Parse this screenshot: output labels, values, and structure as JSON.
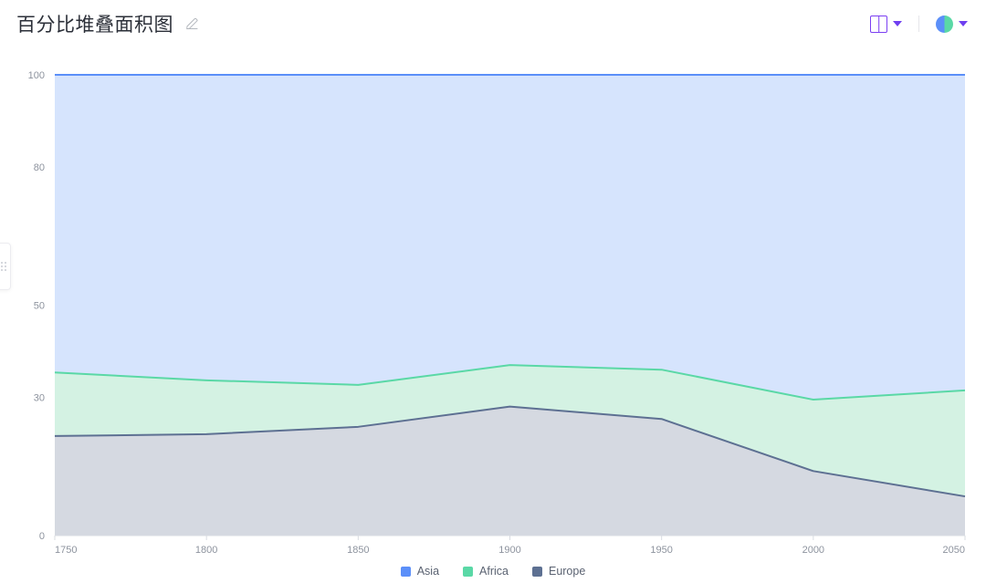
{
  "header": {
    "title": "百分比堆叠面积图",
    "edit_icon": "pencil-icon",
    "layout_button": {
      "icon": "columns-layout-icon",
      "caret": "chevron-down-icon"
    },
    "theme_button": {
      "icon": "color-theme-circle-icon",
      "caret": "chevron-down-icon"
    },
    "accent_color": "#7b3ff2"
  },
  "chart_data": {
    "type": "area",
    "title": "百分比堆叠面积图",
    "stacked": true,
    "normalized": true,
    "xlabel": "",
    "ylabel": "",
    "x": [
      1750,
      1800,
      1850,
      1900,
      1950,
      2000,
      2050
    ],
    "xticks": [
      "1750",
      "1800",
      "1850",
      "1900",
      "1950",
      "2000",
      "2050"
    ],
    "yticks": [
      "0",
      "30",
      "50",
      "80",
      "100"
    ],
    "ytick_values": [
      0,
      30,
      50,
      80,
      100
    ],
    "xlim": [
      1750,
      2050
    ],
    "ylim": [
      0,
      100
    ],
    "grid": true,
    "legend_position": "bottom",
    "series": [
      {
        "name": "Europe",
        "color": "#5d7092",
        "fill": "#d5d9e1",
        "values": [
          21.6,
          22.0,
          23.6,
          28.0,
          25.3,
          14.0,
          8.5
        ],
        "cumulative": [
          21.6,
          22.0,
          23.6,
          28.0,
          25.3,
          14.0,
          8.5
        ]
      },
      {
        "name": "Africa",
        "color": "#5ad8a6",
        "fill": "#d4f2e3",
        "values": [
          13.8,
          11.7,
          9.1,
          9.0,
          10.7,
          15.5,
          23.0
        ],
        "cumulative": [
          35.4,
          33.7,
          32.7,
          37.0,
          36.0,
          29.5,
          31.5
        ]
      },
      {
        "name": "Asia",
        "color": "#5b8ff9",
        "fill": "#d6e4fd",
        "values": [
          64.6,
          66.3,
          67.3,
          63.0,
          64.0,
          70.5,
          68.5
        ],
        "cumulative": [
          100,
          100,
          100,
          100,
          100,
          100,
          100
        ]
      }
    ],
    "legend": [
      {
        "label": "Asia",
        "color": "#5b8ff9"
      },
      {
        "label": "Africa",
        "color": "#5ad8a6"
      },
      {
        "label": "Europe",
        "color": "#5d7092"
      }
    ]
  }
}
